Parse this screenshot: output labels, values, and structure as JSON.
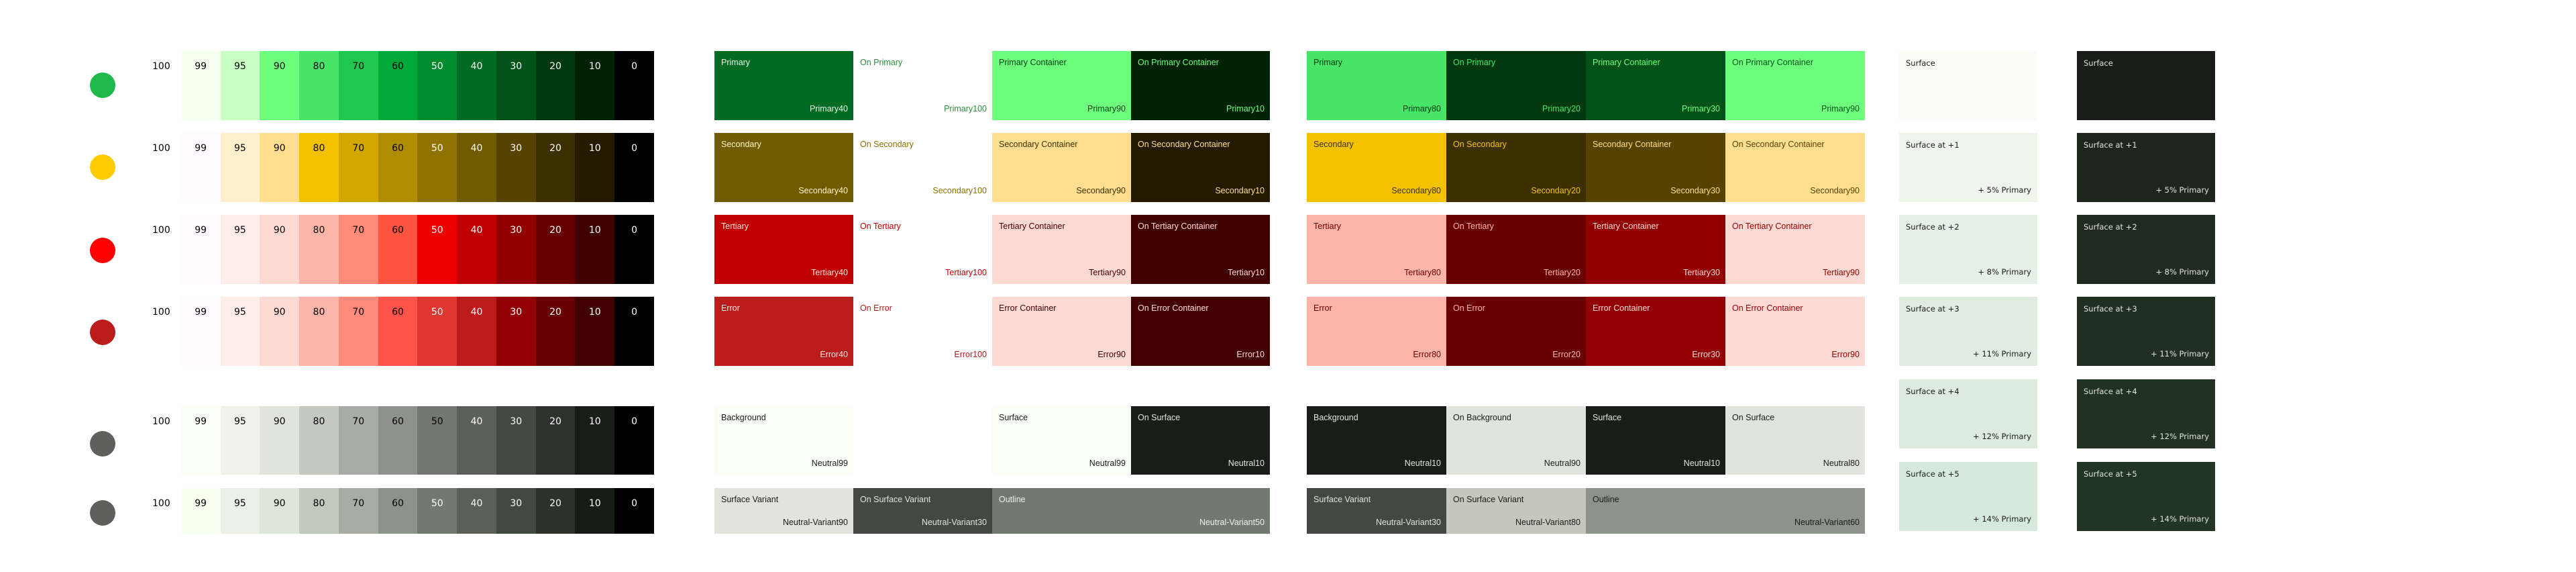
{
  "palettes": [
    {
      "key": "primary",
      "seed": "#1DB94A",
      "tones": [
        "100",
        "99",
        "95",
        "90",
        "80",
        "70",
        "60",
        "50",
        "40",
        "30",
        "20",
        "10",
        "0"
      ],
      "colors": [
        "#FFFFFF",
        "#F6FFF0",
        "#C8FFC3",
        "#6FFF7E",
        "#48E468",
        "#1FC74F",
        "#00A83A",
        "#008B2F",
        "#006B22",
        "#005218",
        "#00390E",
        "#002204",
        "#000000"
      ],
      "text": [
        "#000",
        "#000",
        "#000",
        "#000",
        "#000",
        "#000",
        "#000",
        "#fff",
        "#fff",
        "#fff",
        "#fff",
        "#fff",
        "#fff"
      ]
    },
    {
      "key": "secondary",
      "seed": "#FFCC00",
      "tones": [
        "100",
        "99",
        "95",
        "90",
        "80",
        "70",
        "60",
        "50",
        "40",
        "30",
        "20",
        "10",
        "0"
      ],
      "colors": [
        "#FFFFFF",
        "#FFFBFF",
        "#FFEFCB",
        "#FFDF8F",
        "#F2C200",
        "#D1A700",
        "#AF8C00",
        "#8F7200",
        "#715B00",
        "#564300",
        "#3C2F00",
        "#241A00",
        "#000000"
      ],
      "text": [
        "#000",
        "#000",
        "#000",
        "#000",
        "#000",
        "#000",
        "#000",
        "#fff",
        "#fff",
        "#fff",
        "#fff",
        "#fff",
        "#fff"
      ]
    },
    {
      "key": "tertiary",
      "seed": "#FF0000",
      "tones": [
        "100",
        "99",
        "95",
        "90",
        "80",
        "70",
        "60",
        "50",
        "40",
        "30",
        "20",
        "10",
        "0"
      ],
      "colors": [
        "#FFFFFF",
        "#FFFBFF",
        "#FFEDE9",
        "#FFDAD4",
        "#FFB4A8",
        "#FF8A78",
        "#FF5440",
        "#EF0000",
        "#C00000",
        "#930000",
        "#690000",
        "#410000",
        "#000000"
      ],
      "text": [
        "#000",
        "#000",
        "#000",
        "#000",
        "#000",
        "#000",
        "#000",
        "#fff",
        "#fff",
        "#fff",
        "#fff",
        "#fff",
        "#fff"
      ]
    },
    {
      "key": "error",
      "seed": "#BA1B1B",
      "tones": [
        "100",
        "99",
        "95",
        "90",
        "80",
        "70",
        "60",
        "50",
        "40",
        "30",
        "20",
        "10",
        "0"
      ],
      "colors": [
        "#FFFFFF",
        "#FFFBFF",
        "#FFEDE9",
        "#FFDAD4",
        "#FFB4A9",
        "#FF897A",
        "#FF5449",
        "#DD3730",
        "#BA1B1B",
        "#930006",
        "#680003",
        "#410001",
        "#000000"
      ],
      "text": [
        "#000",
        "#000",
        "#000",
        "#000",
        "#000",
        "#000",
        "#000",
        "#fff",
        "#fff",
        "#fff",
        "#fff",
        "#fff",
        "#fff"
      ]
    },
    {
      "key": "neutral",
      "seed": "#5F5F5C",
      "tones": [
        "100",
        "99",
        "95",
        "90",
        "80",
        "70",
        "60",
        "50",
        "40",
        "30",
        "20",
        "10",
        "0"
      ],
      "colors": [
        "#FFFFFF",
        "#FBFDF7",
        "#F0F1EB",
        "#E1E3DD",
        "#C5C7C1",
        "#A9ACA6",
        "#8F918C",
        "#757872",
        "#5C5F5A",
        "#444843",
        "#2E312D",
        "#1A1C19",
        "#000000"
      ],
      "text": [
        "#000",
        "#000",
        "#000",
        "#000",
        "#000",
        "#000",
        "#000",
        "#000",
        "#fff",
        "#fff",
        "#fff",
        "#fff",
        "#fff"
      ]
    },
    {
      "key": "neutral-variant",
      "seed": "#5F605B",
      "tones": [
        "100",
        "99",
        "95",
        "90",
        "80",
        "70",
        "60",
        "50",
        "40",
        "30",
        "20",
        "10",
        "0"
      ],
      "colors": [
        "#FFFFFF",
        "#F6FFF0",
        "#ECF1E7",
        "#DEE5D9",
        "#C2C9BD",
        "#A7ADA2",
        "#8C9388",
        "#727970",
        "#5A6057",
        "#424940",
        "#2C322A",
        "#171D16",
        "#000000"
      ],
      "text": [
        "#000",
        "#000",
        "#000",
        "#000",
        "#000",
        "#000",
        "#000",
        "#fff",
        "#fff",
        "#fff",
        "#fff",
        "#fff",
        "#fff"
      ]
    }
  ],
  "light_scheme": [
    [
      {
        "name": "Primary",
        "token": "Primary40",
        "bg": "#006B22",
        "fg": "#E8F5E9"
      },
      {
        "name": "On Primary",
        "token": "Primary100",
        "bg": "#FFFFFF",
        "fg": "#2E8B3E"
      },
      {
        "name": "Primary Container",
        "token": "Primary90",
        "bg": "#6FFF7E",
        "fg": "#0A3A12"
      },
      {
        "name": "On Primary Container",
        "token": "Primary10",
        "bg": "#002204",
        "fg": "#6FFF7E"
      }
    ],
    [
      {
        "name": "Secondary",
        "token": "Secondary40",
        "bg": "#715B00",
        "fg": "#FFF2CC"
      },
      {
        "name": "On Secondary",
        "token": "Secondary100",
        "bg": "#FFFFFF",
        "fg": "#8F7200"
      },
      {
        "name": "Secondary Container",
        "token": "Secondary90",
        "bg": "#FFDF8F",
        "fg": "#3C2F00"
      },
      {
        "name": "On Secondary Container",
        "token": "Secondary10",
        "bg": "#241A00",
        "fg": "#FFDF8F"
      }
    ],
    [
      {
        "name": "Tertiary",
        "token": "Tertiary40",
        "bg": "#C00000",
        "fg": "#FFE4DF"
      },
      {
        "name": "On Tertiary",
        "token": "Tertiary100",
        "bg": "#FFFFFF",
        "fg": "#C00000"
      },
      {
        "name": "Tertiary Container",
        "token": "Tertiary90",
        "bg": "#FFDAD4",
        "fg": "#410000"
      },
      {
        "name": "On Tertiary Container",
        "token": "Tertiary10",
        "bg": "#410000",
        "fg": "#FFDAD4"
      }
    ],
    [
      {
        "name": "Error",
        "token": "Error40",
        "bg": "#BA1B1B",
        "fg": "#FFE4DF"
      },
      {
        "name": "On Error",
        "token": "Error100",
        "bg": "#FFFFFF",
        "fg": "#BA1B1B"
      },
      {
        "name": "Error Container",
        "token": "Error90",
        "bg": "#FFDAD4",
        "fg": "#410001"
      },
      {
        "name": "On Error Container",
        "token": "Error10",
        "bg": "#410001",
        "fg": "#FFDAD4"
      }
    ],
    [
      {
        "name": "Background",
        "token": "Neutral99",
        "bg": "#FBFDF7",
        "fg": "#1A1C19"
      },
      {
        "name": "",
        "token": "",
        "bg": "#FFFFFF",
        "fg": "#1A1C19"
      },
      {
        "name": "Surface",
        "token": "Neutral99",
        "bg": "#FBFDF7",
        "fg": "#1A1C19"
      },
      {
        "name": "On Surface",
        "token": "Neutral10",
        "bg": "#1A1C19",
        "fg": "#E1E3DD"
      }
    ],
    [
      {
        "name": "Surface Variant",
        "token": "Neutral-Variant90",
        "bg": "#E2E3DA",
        "fg": "#1A1C19",
        "span": 1
      },
      {
        "name": "On Surface Variant",
        "token": "Neutral-Variant30",
        "bg": "#444843",
        "fg": "#E1E3DD",
        "span": 1
      },
      {
        "name": "Outline",
        "token": "Neutral-Variant50",
        "bg": "#727970",
        "fg": "#F0F1EB",
        "span": 2
      }
    ]
  ],
  "dark_scheme": [
    [
      {
        "name": "Primary",
        "token": "Primary80",
        "bg": "#48E468",
        "fg": "#00390E"
      },
      {
        "name": "On Primary",
        "token": "Primary20",
        "bg": "#00390E",
        "fg": "#48E468"
      },
      {
        "name": "Primary Container",
        "token": "Primary30",
        "bg": "#005218",
        "fg": "#6FFF7E"
      },
      {
        "name": "On Primary Container",
        "token": "Primary90",
        "bg": "#6FFF7E",
        "fg": "#005218"
      }
    ],
    [
      {
        "name": "Secondary",
        "token": "Secondary80",
        "bg": "#F2C200",
        "fg": "#3C2F00"
      },
      {
        "name": "On Secondary",
        "token": "Secondary20",
        "bg": "#3C2F00",
        "fg": "#F2C200"
      },
      {
        "name": "Secondary Container",
        "token": "Secondary30",
        "bg": "#564300",
        "fg": "#FFDF8F"
      },
      {
        "name": "On Secondary Container",
        "token": "Secondary90",
        "bg": "#FFDF8F",
        "fg": "#564300"
      }
    ],
    [
      {
        "name": "Tertiary",
        "token": "Tertiary80",
        "bg": "#FFB4A8",
        "fg": "#690000"
      },
      {
        "name": "On Tertiary",
        "token": "Tertiary20",
        "bg": "#690000",
        "fg": "#FFB4A8"
      },
      {
        "name": "Tertiary Container",
        "token": "Tertiary30",
        "bg": "#930000",
        "fg": "#FFDAD4"
      },
      {
        "name": "On Tertiary Container",
        "token": "Tertiary90",
        "bg": "#FFDAD4",
        "fg": "#930000"
      }
    ],
    [
      {
        "name": "Error",
        "token": "Error80",
        "bg": "#FFB4A9",
        "fg": "#680003"
      },
      {
        "name": "On Error",
        "token": "Error20",
        "bg": "#680003",
        "fg": "#FFB4A9"
      },
      {
        "name": "Error Container",
        "token": "Error30",
        "bg": "#930006",
        "fg": "#FFDAD4"
      },
      {
        "name": "On Error Container",
        "token": "Error90",
        "bg": "#FFDAD4",
        "fg": "#930006"
      }
    ],
    [
      {
        "name": "Background",
        "token": "Neutral10",
        "bg": "#1A1C19",
        "fg": "#E1E3DD"
      },
      {
        "name": "On Background",
        "token": "Neutral90",
        "bg": "#E1E3DD",
        "fg": "#1A1C19"
      },
      {
        "name": "Surface",
        "token": "Neutral10",
        "bg": "#1A1C19",
        "fg": "#E1E3DD"
      },
      {
        "name": "On Surface",
        "token": "Neutral80",
        "bg": "#E1E3DD",
        "fg": "#1A1C19"
      }
    ],
    [
      {
        "name": "Surface Variant",
        "token": "Neutral-Variant30",
        "bg": "#444843",
        "fg": "#E1E3DD",
        "span": 1
      },
      {
        "name": "On Surface Variant",
        "token": "Neutral-Variant80",
        "bg": "#C5C7BD",
        "fg": "#1A1C19",
        "span": 1
      },
      {
        "name": "Outline",
        "token": "Neutral-Variant60",
        "bg": "#8C9388",
        "fg": "#1A1C19",
        "span": 2
      }
    ]
  ],
  "surfaces_light": [
    {
      "name": "Surface",
      "note": "",
      "bg": "#FBFCF7",
      "fg": "#1A1C19"
    },
    {
      "name": "Surface at +1",
      "note": "+ 5% Primary",
      "bg": "#EEF6EC",
      "fg": "#1A1C19"
    },
    {
      "name": "Surface at +2",
      "note": "+ 8% Primary",
      "bg": "#E6F1E5",
      "fg": "#1A1C19"
    },
    {
      "name": "Surface at +3",
      "note": "+ 11% Primary",
      "bg": "#DFECDF",
      "fg": "#1A1C19"
    },
    {
      "name": "Surface at +4",
      "note": "+ 12% Primary",
      "bg": "#DCEBDE",
      "fg": "#1A1C19"
    },
    {
      "name": "Surface at +5",
      "note": "+ 14% Primary",
      "bg": "#D7E9DA",
      "fg": "#1A1C19"
    }
  ],
  "surfaces_dark": [
    {
      "name": "Surface",
      "note": "",
      "bg": "#1A1C19",
      "fg": "#E1E3DD"
    },
    {
      "name": "Surface at +1",
      "note": "+ 5% Primary",
      "bg": "#1D251D",
      "fg": "#E1E3DD"
    },
    {
      "name": "Surface at +2",
      "note": "+ 8% Primary",
      "bg": "#1F2A20",
      "fg": "#E1E3DD"
    },
    {
      "name": "Surface at +3",
      "note": "+ 11% Primary",
      "bg": "#202F22",
      "fg": "#E1E3DD"
    },
    {
      "name": "Surface at +4",
      "note": "+ 12% Primary",
      "bg": "#213122",
      "fg": "#E1E3DD"
    },
    {
      "name": "Surface at +5",
      "note": "+ 14% Primary",
      "bg": "#223423",
      "fg": "#E1E3DD"
    }
  ]
}
